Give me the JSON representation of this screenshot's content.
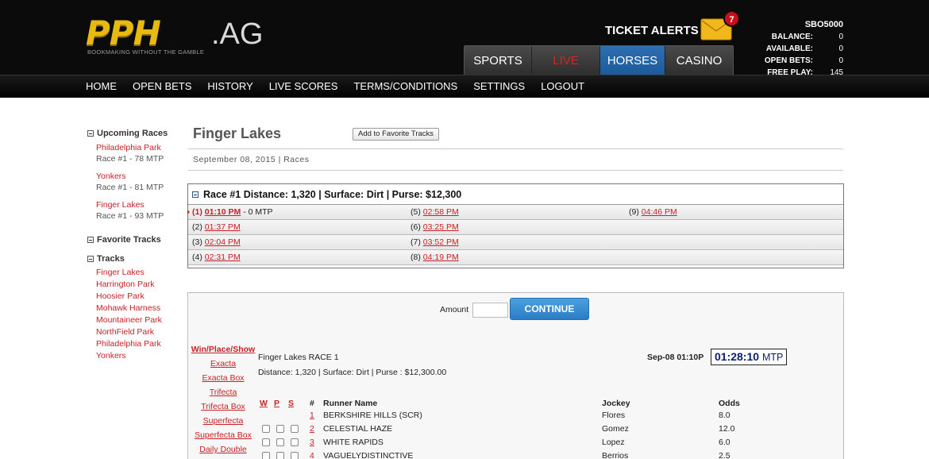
{
  "brand": {
    "logo_main": "PPH",
    "logo_ag": ".AG",
    "tagline": "BOOKMAKING WITHOUT THE GAMBLE"
  },
  "header": {
    "ticket_alerts": "TICKET ALERTS",
    "alert_count": "7",
    "tabs": [
      "SPORTS",
      "LIVE",
      "HORSES",
      "CASINO"
    ],
    "account_id": "SBO5000",
    "account": [
      {
        "label": "BALANCE:",
        "value": "0"
      },
      {
        "label": "AVAILABLE:",
        "value": "0"
      },
      {
        "label": "OPEN BETS:",
        "value": "0"
      },
      {
        "label": "FREE PLAY:",
        "value": "145"
      }
    ]
  },
  "nav": [
    "HOME",
    "OPEN BETS",
    "HISTORY",
    "LIVE SCORES",
    "TERMS/CONDITIONS",
    "SETTINGS",
    "LOGOUT"
  ],
  "sidebar": {
    "upcoming_title": "Upcoming Races",
    "upcoming": [
      {
        "track": "Philadelphia Park",
        "info": "Race #1 - 78 MTP"
      },
      {
        "track": "Yonkers",
        "info": "Race #1 - 81 MTP"
      },
      {
        "track": "Finger Lakes",
        "info": "Race #1 - 93 MTP"
      }
    ],
    "favorites_title": "Favorite Tracks",
    "tracks_title": "Tracks",
    "tracks": [
      "Finger Lakes",
      "Harrington Park",
      "Hoosier Park",
      "Mohawk Harness",
      "Mountaineer Park",
      "NorthField Park",
      "Philadelphia Park",
      "Yonkers"
    ]
  },
  "main": {
    "title": "Finger Lakes",
    "fav_button": "Add to Favorite Tracks",
    "date_line": "September 08, 2015 | Races",
    "race_header": "Race #1 Distance: 1,320 | Surface: Dirt | Purse: $12,300",
    "races": [
      {
        "num": "(1)",
        "time": "01:10 PM",
        "extra": " - 0 MTP"
      },
      {
        "num": "(2)",
        "time": "01:37 PM",
        "extra": ""
      },
      {
        "num": "(3)",
        "time": "02:04 PM",
        "extra": ""
      },
      {
        "num": "(4)",
        "time": "02:31 PM",
        "extra": ""
      },
      {
        "num": "(5)",
        "time": "02:58 PM",
        "extra": ""
      },
      {
        "num": "(6)",
        "time": "03:25 PM",
        "extra": ""
      },
      {
        "num": "(7)",
        "time": "03:52 PM",
        "extra": ""
      },
      {
        "num": "(8)",
        "time": "04:19 PM",
        "extra": ""
      },
      {
        "num": "(9)",
        "time": "04:46 PM",
        "extra": ""
      }
    ]
  },
  "bet": {
    "amount_label": "Amount",
    "amount_value": "",
    "continue_label": "CONTINUE",
    "types": [
      "Win/Place/Show",
      "Exacta",
      "Exacta Box",
      "Trifecta",
      "Trifecta Box",
      "Superfecta",
      "Superfecta Box",
      "Daily Double"
    ],
    "race_title": "Finger Lakes RACE 1",
    "race_sub": "Distance: 1,320 | Surface: Dirt | Purse : $12,300.00",
    "race_time": "Sep-08 01:10P",
    "countdown": "01:28:10",
    "countdown_label": "MTP",
    "headers": {
      "w": "W",
      "p": "P",
      "s": "S",
      "num": "#",
      "runner": "Runner Name",
      "jockey": "Jockey",
      "odds": "Odds"
    },
    "runners": [
      {
        "num": "1",
        "name": "BERKSHIRE HILLS (SCR)",
        "jockey": "Flores",
        "odds": "8.0",
        "scratched": true
      },
      {
        "num": "2",
        "name": "CELESTIAL HAZE",
        "jockey": "Gomez",
        "odds": "12.0",
        "scratched": false
      },
      {
        "num": "3",
        "name": "WHITE RAPIDS",
        "jockey": "Lopez",
        "odds": "6.0",
        "scratched": false
      },
      {
        "num": "4",
        "name": "VAGUELYDISTINCTIVE",
        "jockey": "Berrios",
        "odds": "2.5",
        "scratched": false
      }
    ]
  }
}
